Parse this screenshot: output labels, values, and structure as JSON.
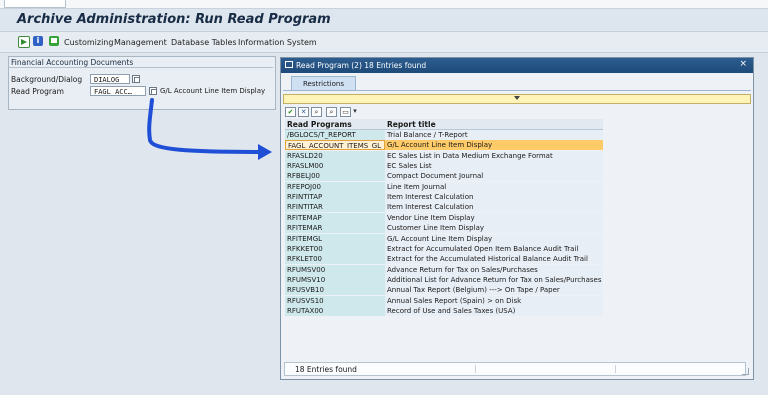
{
  "window": {
    "title": "Archive Administration: Run Read Program"
  },
  "toolbar": {
    "icons": [
      "execute-icon",
      "info-icon",
      "variants-icon"
    ],
    "menu": [
      "Customizing",
      "Management",
      "Database Tables",
      "Information System"
    ]
  },
  "selection": {
    "group_title": "Financial Accounting Documents",
    "background_label": "Background/Dialog",
    "background_value": "DIALOG",
    "read_program_label": "Read Program",
    "read_program_value": "FAGL_ACC…",
    "read_program_desc": "G/L Account Line Item Display"
  },
  "popup": {
    "title": "Read Program (2)   18 Entries found",
    "tab": "Restrictions",
    "columns": [
      "Read Programs",
      "Report title"
    ],
    "rows": [
      {
        "program": "/BGLOCS/T_REPORT",
        "title": "Trial Balance / T-Report"
      },
      {
        "program": "FAGL_ACCOUNT_ITEMS_GL",
        "title": "G/L Account Line Item Display"
      },
      {
        "program": "RFASLD20",
        "title": "EC Sales List in Data Medium Exchange Format"
      },
      {
        "program": "RFASLM00",
        "title": "EC Sales List"
      },
      {
        "program": "RFBELJ00",
        "title": "Compact Document Journal"
      },
      {
        "program": "RFEPOJ00",
        "title": "Line Item Journal"
      },
      {
        "program": "RFINTITAP",
        "title": "Item Interest Calculation"
      },
      {
        "program": "RFINTITAR",
        "title": "Item Interest Calculation"
      },
      {
        "program": "RFITEMAP",
        "title": "Vendor Line Item Display"
      },
      {
        "program": "RFITEMAR",
        "title": "Customer Line Item Display"
      },
      {
        "program": "RFITEMGL",
        "title": "G/L Account Line Item Display"
      },
      {
        "program": "RFKKET00",
        "title": "Extract for Accumulated Open Item Balance Audit Trail"
      },
      {
        "program": "RFKLET00",
        "title": "Extract for the Accumulated Historical Balance Audit Trail"
      },
      {
        "program": "RFUMSV00",
        "title": "Advance Return for Tax on Sales/Purchases"
      },
      {
        "program": "RFUMSV10",
        "title": "Additional List for Advance Return for Tax on Sales/Purchases"
      },
      {
        "program": "RFUSVB10",
        "title": "Annual Tax Report (Belgium) ---> On Tape / Paper"
      },
      {
        "program": "RFUSVS10",
        "title": "Annual Sales Report (Spain)    > on Disk"
      },
      {
        "program": "RFUTAX00",
        "title": "Record of Use and Sales Taxes (USA)"
      }
    ],
    "selected_index": 1,
    "status": "18 Entries found",
    "close": "×"
  },
  "colors": {
    "title_bar": "#1d4a79",
    "selected_row": "#ffcb69",
    "annotation_arrow": "#1f4fd6"
  }
}
